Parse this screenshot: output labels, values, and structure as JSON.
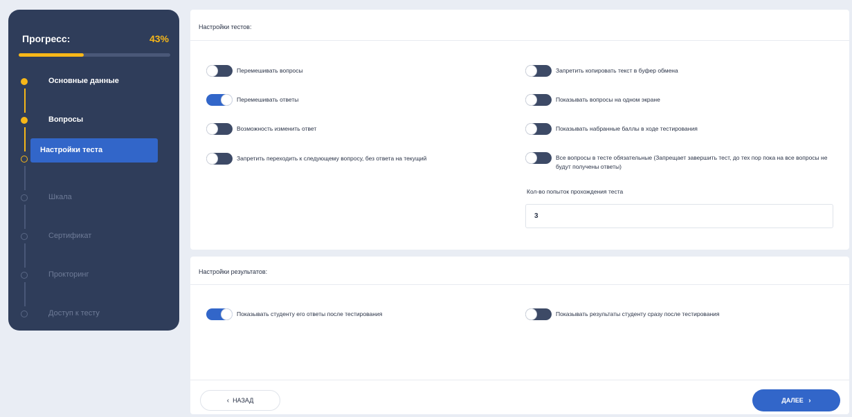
{
  "sidebar": {
    "progress_label": "Прогресс:",
    "progress_percent_text": "43%",
    "progress_value": 43,
    "steps": [
      {
        "label": "Основные данные",
        "state": "done"
      },
      {
        "label": "Вопросы",
        "state": "done"
      },
      {
        "label": "Настройки теста",
        "state": "current"
      },
      {
        "label": "Шкала",
        "state": "todo"
      },
      {
        "label": "Сертификат",
        "state": "todo"
      },
      {
        "label": "Прокторинг",
        "state": "todo"
      },
      {
        "label": "Доступ к тесту",
        "state": "todo"
      }
    ]
  },
  "test_settings": {
    "title": "Настройки тестов:",
    "left_toggles": [
      {
        "label": "Перемешивать вопросы",
        "on": false
      },
      {
        "label": "Перемешивать ответы",
        "on": true
      },
      {
        "label": "Возможность изменить ответ",
        "on": false
      },
      {
        "label": "Запретить переходить к следующему вопросу, без ответа на текущий",
        "on": false
      }
    ],
    "right_toggles": [
      {
        "label": "Запретить копировать текст в буфер обмена",
        "on": false
      },
      {
        "label": "Показывать вопросы на одном экране",
        "on": false
      },
      {
        "label": "Показывать набранные баллы в ходе тестирования",
        "on": false
      },
      {
        "label": "Все вопросы в тесте обязательные (Запрещает завершить тест, до тех пор пока на все вопросы не будут получены ответы)",
        "on": false
      }
    ],
    "attempts_label": "Кол-во попыток прохождения теста",
    "attempts_value": "3"
  },
  "result_settings": {
    "title": "Настройки результатов:",
    "left_toggle": {
      "label": "Показывать студенту его ответы после тестирования",
      "on": true
    },
    "right_toggle": {
      "label": "Показывать результаты студенту сразу после тестирования",
      "on": false
    }
  },
  "footer": {
    "back_label": "НАЗАД",
    "next_label": "ДАЛЕЕ"
  },
  "colors": {
    "accent": "#3266c9",
    "progress": "#f7b718",
    "sidebar_bg": "#2f3d5a"
  }
}
